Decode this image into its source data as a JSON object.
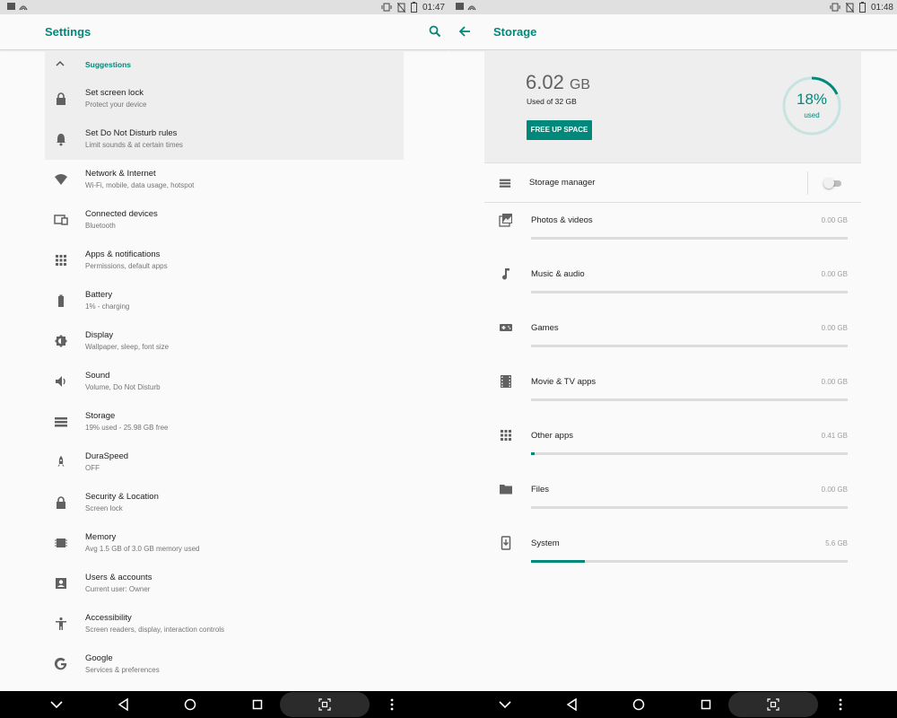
{
  "left_pane": {
    "status_time": "01:47",
    "title": "Settings",
    "suggestions_label": "Suggestions",
    "suggestions": [
      {
        "title": "Set screen lock",
        "subtitle": "Protect your device"
      },
      {
        "title": "Set Do Not Disturb rules",
        "subtitle": "Limit sounds & at certain times"
      }
    ],
    "items": [
      {
        "title": "Network & Internet",
        "subtitle": "Wi-Fi, mobile, data usage, hotspot",
        "icon": "wifi-icon"
      },
      {
        "title": "Connected devices",
        "subtitle": "Bluetooth",
        "icon": "devices-icon"
      },
      {
        "title": "Apps & notifications",
        "subtitle": "Permissions, default apps",
        "icon": "apps-icon"
      },
      {
        "title": "Battery",
        "subtitle": "1% - charging",
        "icon": "battery-icon"
      },
      {
        "title": "Display",
        "subtitle": "Wallpaper, sleep, font size",
        "icon": "brightness-icon"
      },
      {
        "title": "Sound",
        "subtitle": "Volume, Do Not Disturb",
        "icon": "volume-icon"
      },
      {
        "title": "Storage",
        "subtitle": "19% used - 25.98 GB free",
        "icon": "storage-icon"
      },
      {
        "title": "DuraSpeed",
        "subtitle": "OFF",
        "icon": "rocket-icon"
      },
      {
        "title": "Security & Location",
        "subtitle": "Screen lock",
        "icon": "lock-icon"
      },
      {
        "title": "Memory",
        "subtitle": "Avg 1.5 GB of 3.0 GB memory used",
        "icon": "memory-icon"
      },
      {
        "title": "Users & accounts",
        "subtitle": "Current user: Owner",
        "icon": "account-icon"
      },
      {
        "title": "Accessibility",
        "subtitle": "Screen readers, display, interaction controls",
        "icon": "accessibility-icon"
      },
      {
        "title": "Google",
        "subtitle": "Services & preferences",
        "icon": "google-icon"
      }
    ]
  },
  "right_pane": {
    "status_time": "01:48",
    "title": "Storage",
    "used_amount": "6.02",
    "used_unit": "GB",
    "used_of": "Used of 32 GB",
    "free_up_button": "FREE UP SPACE",
    "percent_used": "18%",
    "percent_label": "used",
    "percent_value": 18,
    "storage_manager_label": "Storage manager",
    "storage_manager_enabled": false,
    "categories": [
      {
        "name": "Photos & videos",
        "size": "0.00 GB",
        "fraction": 0.0,
        "icon": "photo-icon"
      },
      {
        "name": "Music & audio",
        "size": "0.00 GB",
        "fraction": 0.0,
        "icon": "music-icon"
      },
      {
        "name": "Games",
        "size": "0.00 GB",
        "fraction": 0.0,
        "icon": "gamepad-icon"
      },
      {
        "name": "Movie & TV apps",
        "size": "0.00 GB",
        "fraction": 0.0,
        "icon": "movie-icon"
      },
      {
        "name": "Other apps",
        "size": "0.41 GB",
        "fraction": 0.01,
        "icon": "apps-icon"
      },
      {
        "name": "Files",
        "size": "0.00 GB",
        "fraction": 0.0,
        "icon": "folder-icon"
      },
      {
        "name": "System",
        "size": "5.6 GB",
        "fraction": 0.17,
        "icon": "system-update-icon"
      }
    ]
  },
  "colors": {
    "accent": "#00897b",
    "icon_gray": "#616161"
  },
  "navbar": {
    "buttons": [
      "chevron-down-icon",
      "back-triangle-icon",
      "home-circle-icon",
      "recents-square-icon",
      "screenshot-icon",
      "more-vert-icon"
    ]
  }
}
